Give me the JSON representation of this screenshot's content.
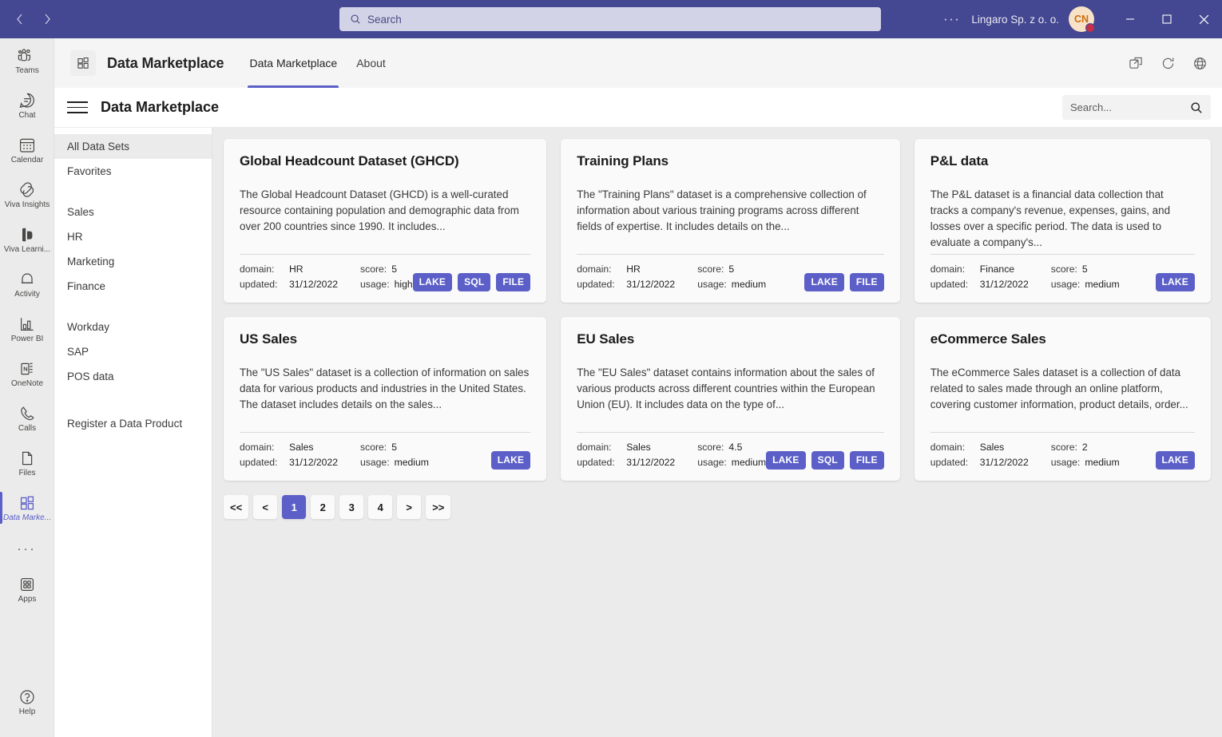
{
  "titlebar": {
    "back_label": "‹",
    "forward_label": "›",
    "search_placeholder": "Search",
    "overflow_label": "···",
    "org_name": "Lingaro Sp. z o. o.",
    "avatar_initials": "CN",
    "minimize_label": "—",
    "maximize_label": "▢",
    "close_label": "✕"
  },
  "rail": {
    "items": [
      {
        "label": "Teams",
        "icon": "teams-icon",
        "active": false
      },
      {
        "label": "Chat",
        "icon": "chat-icon",
        "active": false
      },
      {
        "label": "Calendar",
        "icon": "calendar-icon",
        "active": false
      },
      {
        "label": "Viva Insights",
        "icon": "viva-insights-icon",
        "active": false
      },
      {
        "label": "Viva Learni...",
        "icon": "viva-learning-icon",
        "active": false
      },
      {
        "label": "Activity",
        "icon": "bell-icon",
        "active": false
      },
      {
        "label": "Power BI",
        "icon": "power-bi-icon",
        "active": false
      },
      {
        "label": "OneNote",
        "icon": "onenote-icon",
        "active": false
      },
      {
        "label": "Calls",
        "icon": "phone-icon",
        "active": false
      },
      {
        "label": "Files",
        "icon": "file-icon",
        "active": false
      },
      {
        "label": "Data Marke...",
        "icon": "data-marketplace-icon",
        "active": true
      }
    ],
    "more_label": "···",
    "apps_label": "Apps",
    "help_label": "Help"
  },
  "app_header": {
    "title": "Data Marketplace",
    "tabs": [
      {
        "label": "Data Marketplace",
        "active": true
      },
      {
        "label": "About",
        "active": false
      }
    ],
    "icons": [
      "pop-out-icon",
      "refresh-icon",
      "globe-icon"
    ]
  },
  "dm_bar": {
    "title": "Data Marketplace",
    "search_placeholder": "Search..."
  },
  "side_nav": {
    "groups": [
      {
        "items": [
          {
            "label": "All Data Sets",
            "active": true
          },
          {
            "label": "Favorites",
            "active": false
          }
        ]
      },
      {
        "items": [
          {
            "label": "Sales",
            "active": false
          },
          {
            "label": "HR",
            "active": false
          },
          {
            "label": "Marketing",
            "active": false
          },
          {
            "label": "Finance",
            "active": false
          }
        ]
      },
      {
        "items": [
          {
            "label": "Workday",
            "active": false
          },
          {
            "label": "SAP",
            "active": false
          },
          {
            "label": "POS data",
            "active": false
          }
        ]
      },
      {
        "items": [
          {
            "label": "Register a Data Product",
            "active": false
          }
        ]
      }
    ]
  },
  "labels": {
    "domain": "domain:",
    "updated": "updated:",
    "score": "score:",
    "usage": "usage:"
  },
  "cards": [
    {
      "title": "Global Headcount Dataset (GHCD)",
      "description": "The Global Headcount Dataset (GHCD) is a well-curated resource containing population and demographic data from over 200 countries since 1990. It includes...",
      "domain": "HR",
      "updated": "31/12/2022",
      "score": "5",
      "usage": "high",
      "badges": [
        "LAKE",
        "SQL",
        "FILE"
      ]
    },
    {
      "title": "Training Plans",
      "description": "The \"Training Plans\" dataset is a comprehensive collection of information about various training programs across different fields of expertise. It includes details on the...",
      "domain": "HR",
      "updated": "31/12/2022",
      "score": "5",
      "usage": "medium",
      "badges": [
        "LAKE",
        "FILE"
      ]
    },
    {
      "title": "P&L data",
      "description": "The P&L dataset is a financial data collection that tracks a company's revenue, expenses, gains, and losses over a specific period. The data is used to evaluate a company's...",
      "domain": "Finance",
      "updated": "31/12/2022",
      "score": "5",
      "usage": "medium",
      "badges": [
        "LAKE"
      ]
    },
    {
      "title": "US Sales",
      "description": "The \"US Sales\" dataset is a collection of information on sales data for various products and industries in the United States. The dataset includes details on the sales...",
      "domain": "Sales",
      "updated": "31/12/2022",
      "score": "5",
      "usage": "medium",
      "badges": [
        "LAKE"
      ]
    },
    {
      "title": "EU Sales",
      "description": "The \"EU Sales\" dataset contains information about the sales of various products across different countries within the European Union (EU). It includes data on the type of...",
      "domain": "Sales",
      "updated": "31/12/2022",
      "score": "4.5",
      "usage": "medium",
      "badges": [
        "LAKE",
        "SQL",
        "FILE"
      ]
    },
    {
      "title": "eCommerce Sales",
      "description": "The eCommerce Sales dataset is a collection of data related to sales made through an online platform, covering customer information, product details, order...",
      "domain": "Sales",
      "updated": "31/12/2022",
      "score": "2",
      "usage": "medium",
      "badges": [
        "LAKE"
      ]
    }
  ],
  "pagination": {
    "buttons": [
      {
        "label": "<<",
        "active": false
      },
      {
        "label": "<",
        "active": false
      },
      {
        "label": "1",
        "active": true
      },
      {
        "label": "2",
        "active": false
      },
      {
        "label": "3",
        "active": false
      },
      {
        "label": "4",
        "active": false
      },
      {
        "label": ">",
        "active": false
      },
      {
        "label": ">>",
        "active": false
      }
    ]
  },
  "colors": {
    "brand_purple": "#5b5fc7",
    "titlebar_purple": "#444791",
    "status_red": "#c4314b",
    "canvas_gray": "#ebebeb"
  }
}
